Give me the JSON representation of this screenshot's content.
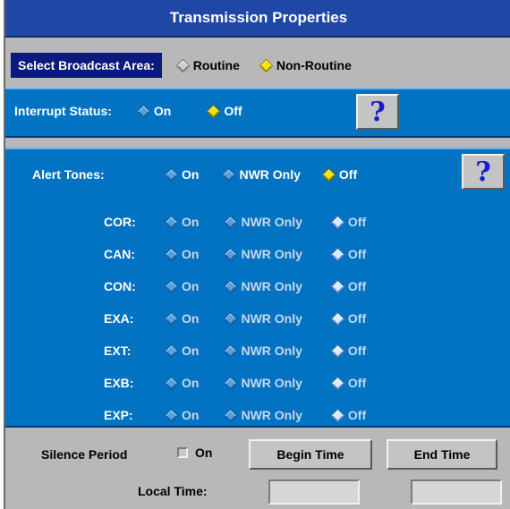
{
  "window": {
    "title": "Transmission Properties"
  },
  "broadcast_area": {
    "label": "Select Broadcast Area:",
    "options": [
      {
        "label": "Routine",
        "selected": false
      },
      {
        "label": "Non-Routine",
        "selected": true
      }
    ]
  },
  "interrupt": {
    "label": "Interrupt Status:",
    "on_label": "On",
    "off_label": "Off",
    "selected": "Off",
    "help_label": "?"
  },
  "alert_tones": {
    "label": "Alert Tones:",
    "on_label": "On",
    "nwr_label": "NWR Only",
    "off_label": "Off",
    "selected": "Off",
    "help_label": "?",
    "codes": [
      {
        "code": "COR:",
        "on": "On",
        "nwr": "NWR Only",
        "off": "Off"
      },
      {
        "code": "CAN:",
        "on": "On",
        "nwr": "NWR Only",
        "off": "Off"
      },
      {
        "code": "CON:",
        "on": "On",
        "nwr": "NWR Only",
        "off": "Off"
      },
      {
        "code": "EXA:",
        "on": "On",
        "nwr": "NWR Only",
        "off": "Off"
      },
      {
        "code": "EXT:",
        "on": "On",
        "nwr": "NWR Only",
        "off": "Off"
      },
      {
        "code": "EXB:",
        "on": "On",
        "nwr": "NWR Only",
        "off": "Off"
      },
      {
        "code": "EXP:",
        "on": "On",
        "nwr": "NWR Only",
        "off": "Off"
      }
    ]
  },
  "silence": {
    "label": "Silence Period",
    "on_label": "On",
    "begin_label": "Begin Time",
    "end_label": "End Time",
    "local_time_label": "Local Time:",
    "begin_value": "",
    "end_value": ""
  },
  "colors": {
    "title_bar": "#1f47a6",
    "panel_blue": "#0272c2",
    "selected_diamond": "#f0e600",
    "area_label_bg": "#0a1a7e",
    "help_glyph": "#1a1ad2"
  }
}
